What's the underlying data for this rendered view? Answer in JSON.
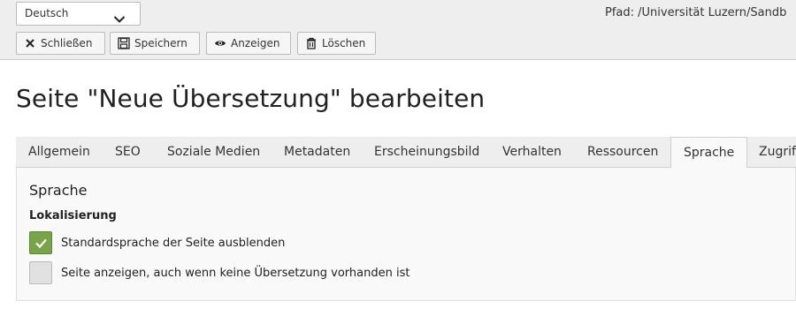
{
  "toolbar": {
    "language_select": "Deutsch",
    "path": "Pfad: /Universität Luzern/Sandb",
    "buttons": {
      "close": "Schließen",
      "save": "Speichern",
      "view": "Anzeigen",
      "delete": "Löschen"
    }
  },
  "page": {
    "title": "Seite \"Neue Übersetzung\" bearbeiten"
  },
  "tabs": [
    "Allgemein",
    "SEO",
    "Soziale Medien",
    "Metadaten",
    "Erscheinungsbild",
    "Verhalten",
    "Ressourcen",
    "Sprache",
    "Zugrif"
  ],
  "active_tab": "Sprache",
  "panel": {
    "section_title": "Sprache",
    "subsection_title": "Lokalisierung",
    "options": [
      {
        "label": "Standardsprache der Seite ausblenden",
        "checked": true
      },
      {
        "label": "Seite anzeigen, auch wenn keine Übersetzung vorhanden ist",
        "checked": false
      }
    ]
  },
  "colors": {
    "checked_accent": "#79a548",
    "toolbar_bg": "#eeeeee"
  },
  "icons": {
    "close": "x-icon",
    "save": "floppy-disk-icon",
    "view": "eye-icon",
    "delete": "trash-icon",
    "select": "chevron-down-icon",
    "check": "checkmark-icon"
  }
}
